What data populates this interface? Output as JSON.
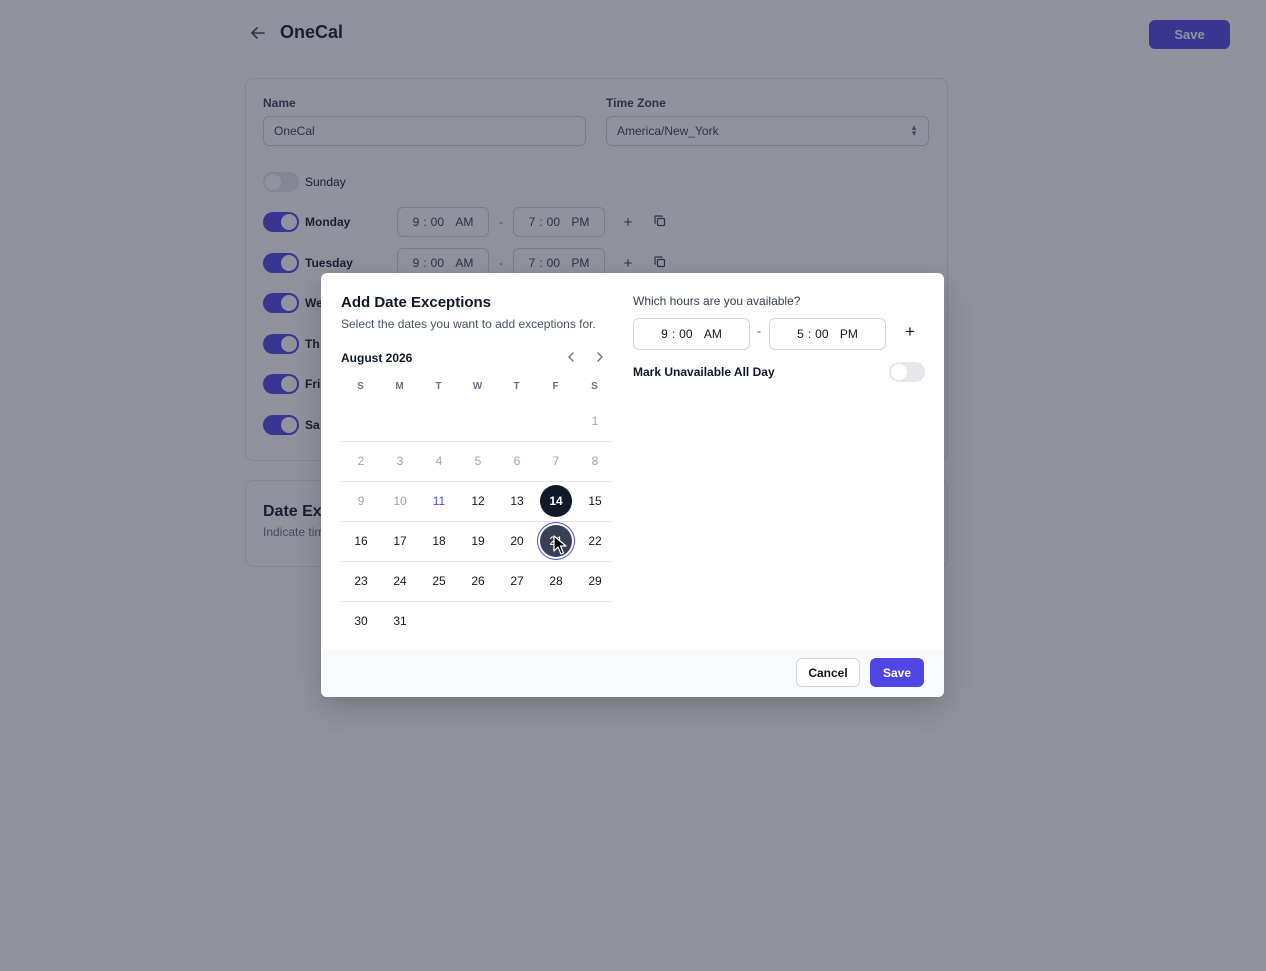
{
  "header": {
    "title": "OneCal",
    "save_label": "Save",
    "back_icon": "arrow-left-icon"
  },
  "schedule": {
    "name_label": "Name",
    "name_value": "OneCal",
    "timezone_label": "Time Zone",
    "timezone_value": "America/New_York",
    "days": [
      {
        "label": "Sunday",
        "enabled": false
      },
      {
        "label": "Monday",
        "enabled": true,
        "start": {
          "h": "9",
          "m": "00",
          "p": "AM"
        },
        "end": {
          "h": "7",
          "m": "00",
          "p": "PM"
        }
      },
      {
        "label": "Tuesday",
        "enabled": true,
        "start": {
          "h": "9",
          "m": "00",
          "p": "AM"
        },
        "end": {
          "h": "7",
          "m": "00",
          "p": "PM"
        }
      },
      {
        "label": "We",
        "enabled": true
      },
      {
        "label": "Th",
        "enabled": true
      },
      {
        "label": "Fri",
        "enabled": true
      },
      {
        "label": "Sa",
        "enabled": true
      }
    ],
    "dash": "-",
    "add_icon": "plus-icon",
    "copy_icon": "copy-icon"
  },
  "date_exceptions_card": {
    "title": "Date Exc",
    "subtitle": "Indicate tim"
  },
  "modal": {
    "title": "Add Date Exceptions",
    "subtitle": "Select the dates you want to add exceptions for.",
    "month_label": "August 2026",
    "weekdays": [
      "S",
      "M",
      "T",
      "W",
      "T",
      "F",
      "S"
    ],
    "weeks": [
      [
        null,
        null,
        null,
        null,
        null,
        null,
        {
          "d": "1",
          "state": "past"
        }
      ],
      [
        {
          "d": "2",
          "state": "past"
        },
        {
          "d": "3",
          "state": "past"
        },
        {
          "d": "4",
          "state": "past"
        },
        {
          "d": "5",
          "state": "past"
        },
        {
          "d": "6",
          "state": "past"
        },
        {
          "d": "7",
          "state": "past"
        },
        {
          "d": "8",
          "state": "past"
        }
      ],
      [
        {
          "d": "9",
          "state": "past"
        },
        {
          "d": "10",
          "state": "past"
        },
        {
          "d": "11",
          "state": "today"
        },
        {
          "d": "12",
          "state": "normal"
        },
        {
          "d": "13",
          "state": "normal"
        },
        {
          "d": "14",
          "state": "selected"
        },
        {
          "d": "15",
          "state": "normal"
        }
      ],
      [
        {
          "d": "16",
          "state": "normal"
        },
        {
          "d": "17",
          "state": "normal"
        },
        {
          "d": "18",
          "state": "normal"
        },
        {
          "d": "19",
          "state": "normal"
        },
        {
          "d": "20",
          "state": "normal"
        },
        {
          "d": "21",
          "state": "hovered"
        },
        {
          "d": "22",
          "state": "normal"
        }
      ],
      [
        {
          "d": "23",
          "state": "normal"
        },
        {
          "d": "24",
          "state": "normal"
        },
        {
          "d": "25",
          "state": "normal"
        },
        {
          "d": "26",
          "state": "normal"
        },
        {
          "d": "27",
          "state": "normal"
        },
        {
          "d": "28",
          "state": "normal"
        },
        {
          "d": "29",
          "state": "normal"
        }
      ],
      [
        {
          "d": "30",
          "state": "normal"
        },
        {
          "d": "31",
          "state": "normal"
        },
        null,
        null,
        null,
        null,
        null
      ]
    ],
    "hours_label": "Which hours are you available?",
    "start_time": {
      "h": "9",
      "sep": ":",
      "m": "00",
      "p": "AM"
    },
    "end_time": {
      "h": "5",
      "sep": ":",
      "m": "00",
      "p": "PM"
    },
    "dash": "-",
    "add_symbol": "+",
    "unavailable_label": "Mark Unavailable All Day",
    "unavailable_enabled": false,
    "cancel_label": "Cancel",
    "save_label": "Save"
  },
  "colors": {
    "accent": "#4f46e5",
    "selected_day": "#111827",
    "overlay": "rgba(34, 38, 60, 0.5)"
  }
}
